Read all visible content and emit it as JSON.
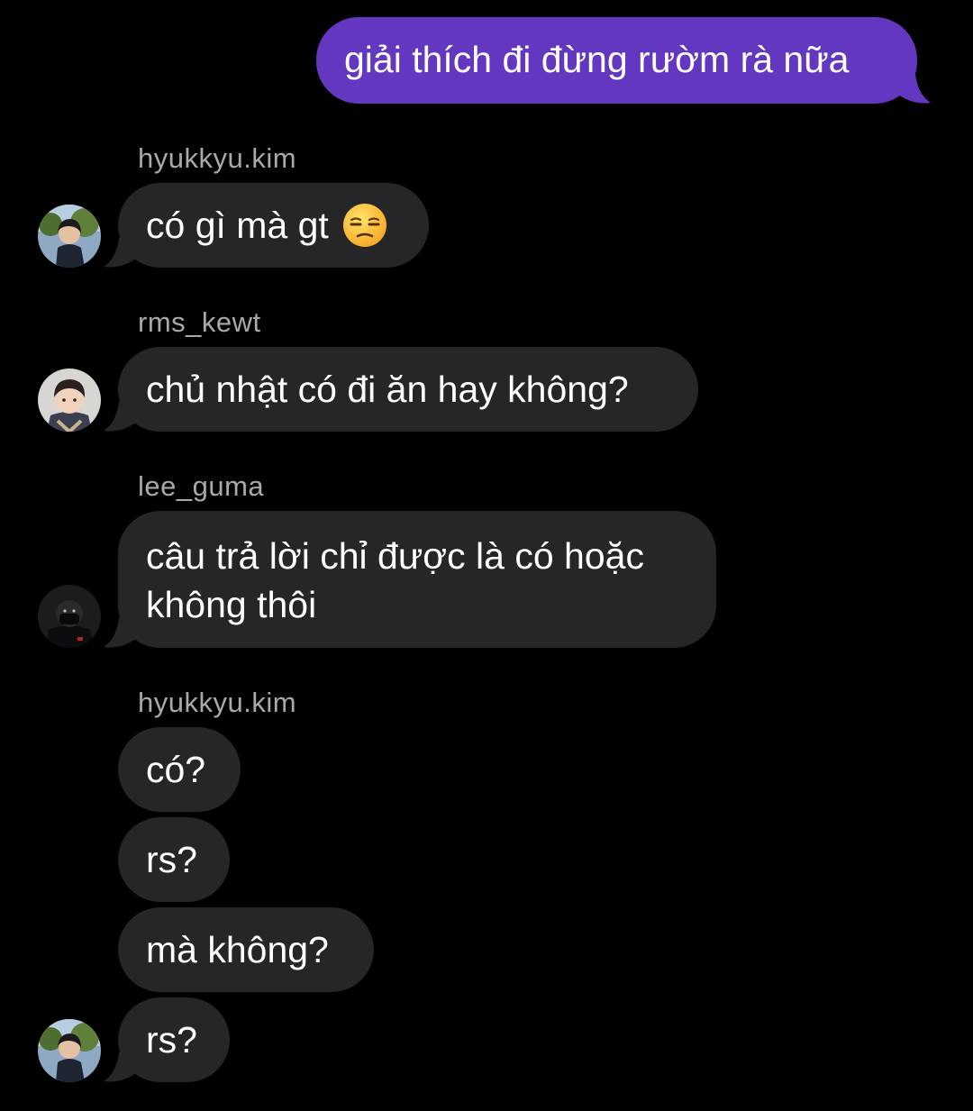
{
  "colors": {
    "background": "#000000",
    "outgoing_bubble": "#6437c1",
    "incoming_bubble": "#262628",
    "sender_label": "#a8a8ad",
    "text": "#ffffff"
  },
  "messages": {
    "m1": {
      "text": "giải thích đi đừng rườm rà nữa",
      "direction": "outgoing"
    },
    "g1": {
      "sender": "hyukkyu.kim",
      "text": "có gì mà gt",
      "emoji": "unamused-face-emoji"
    },
    "g2": {
      "sender": "rms_kewt",
      "text": "chủ nhật có đi ăn hay không?"
    },
    "g3": {
      "sender": "lee_guma",
      "text": "câu trả lời chỉ được là có hoặc không thôi"
    },
    "g4": {
      "sender": "hyukkyu.kim",
      "texts": [
        "có?",
        "rs?",
        "mà không?",
        "rs?"
      ]
    }
  }
}
